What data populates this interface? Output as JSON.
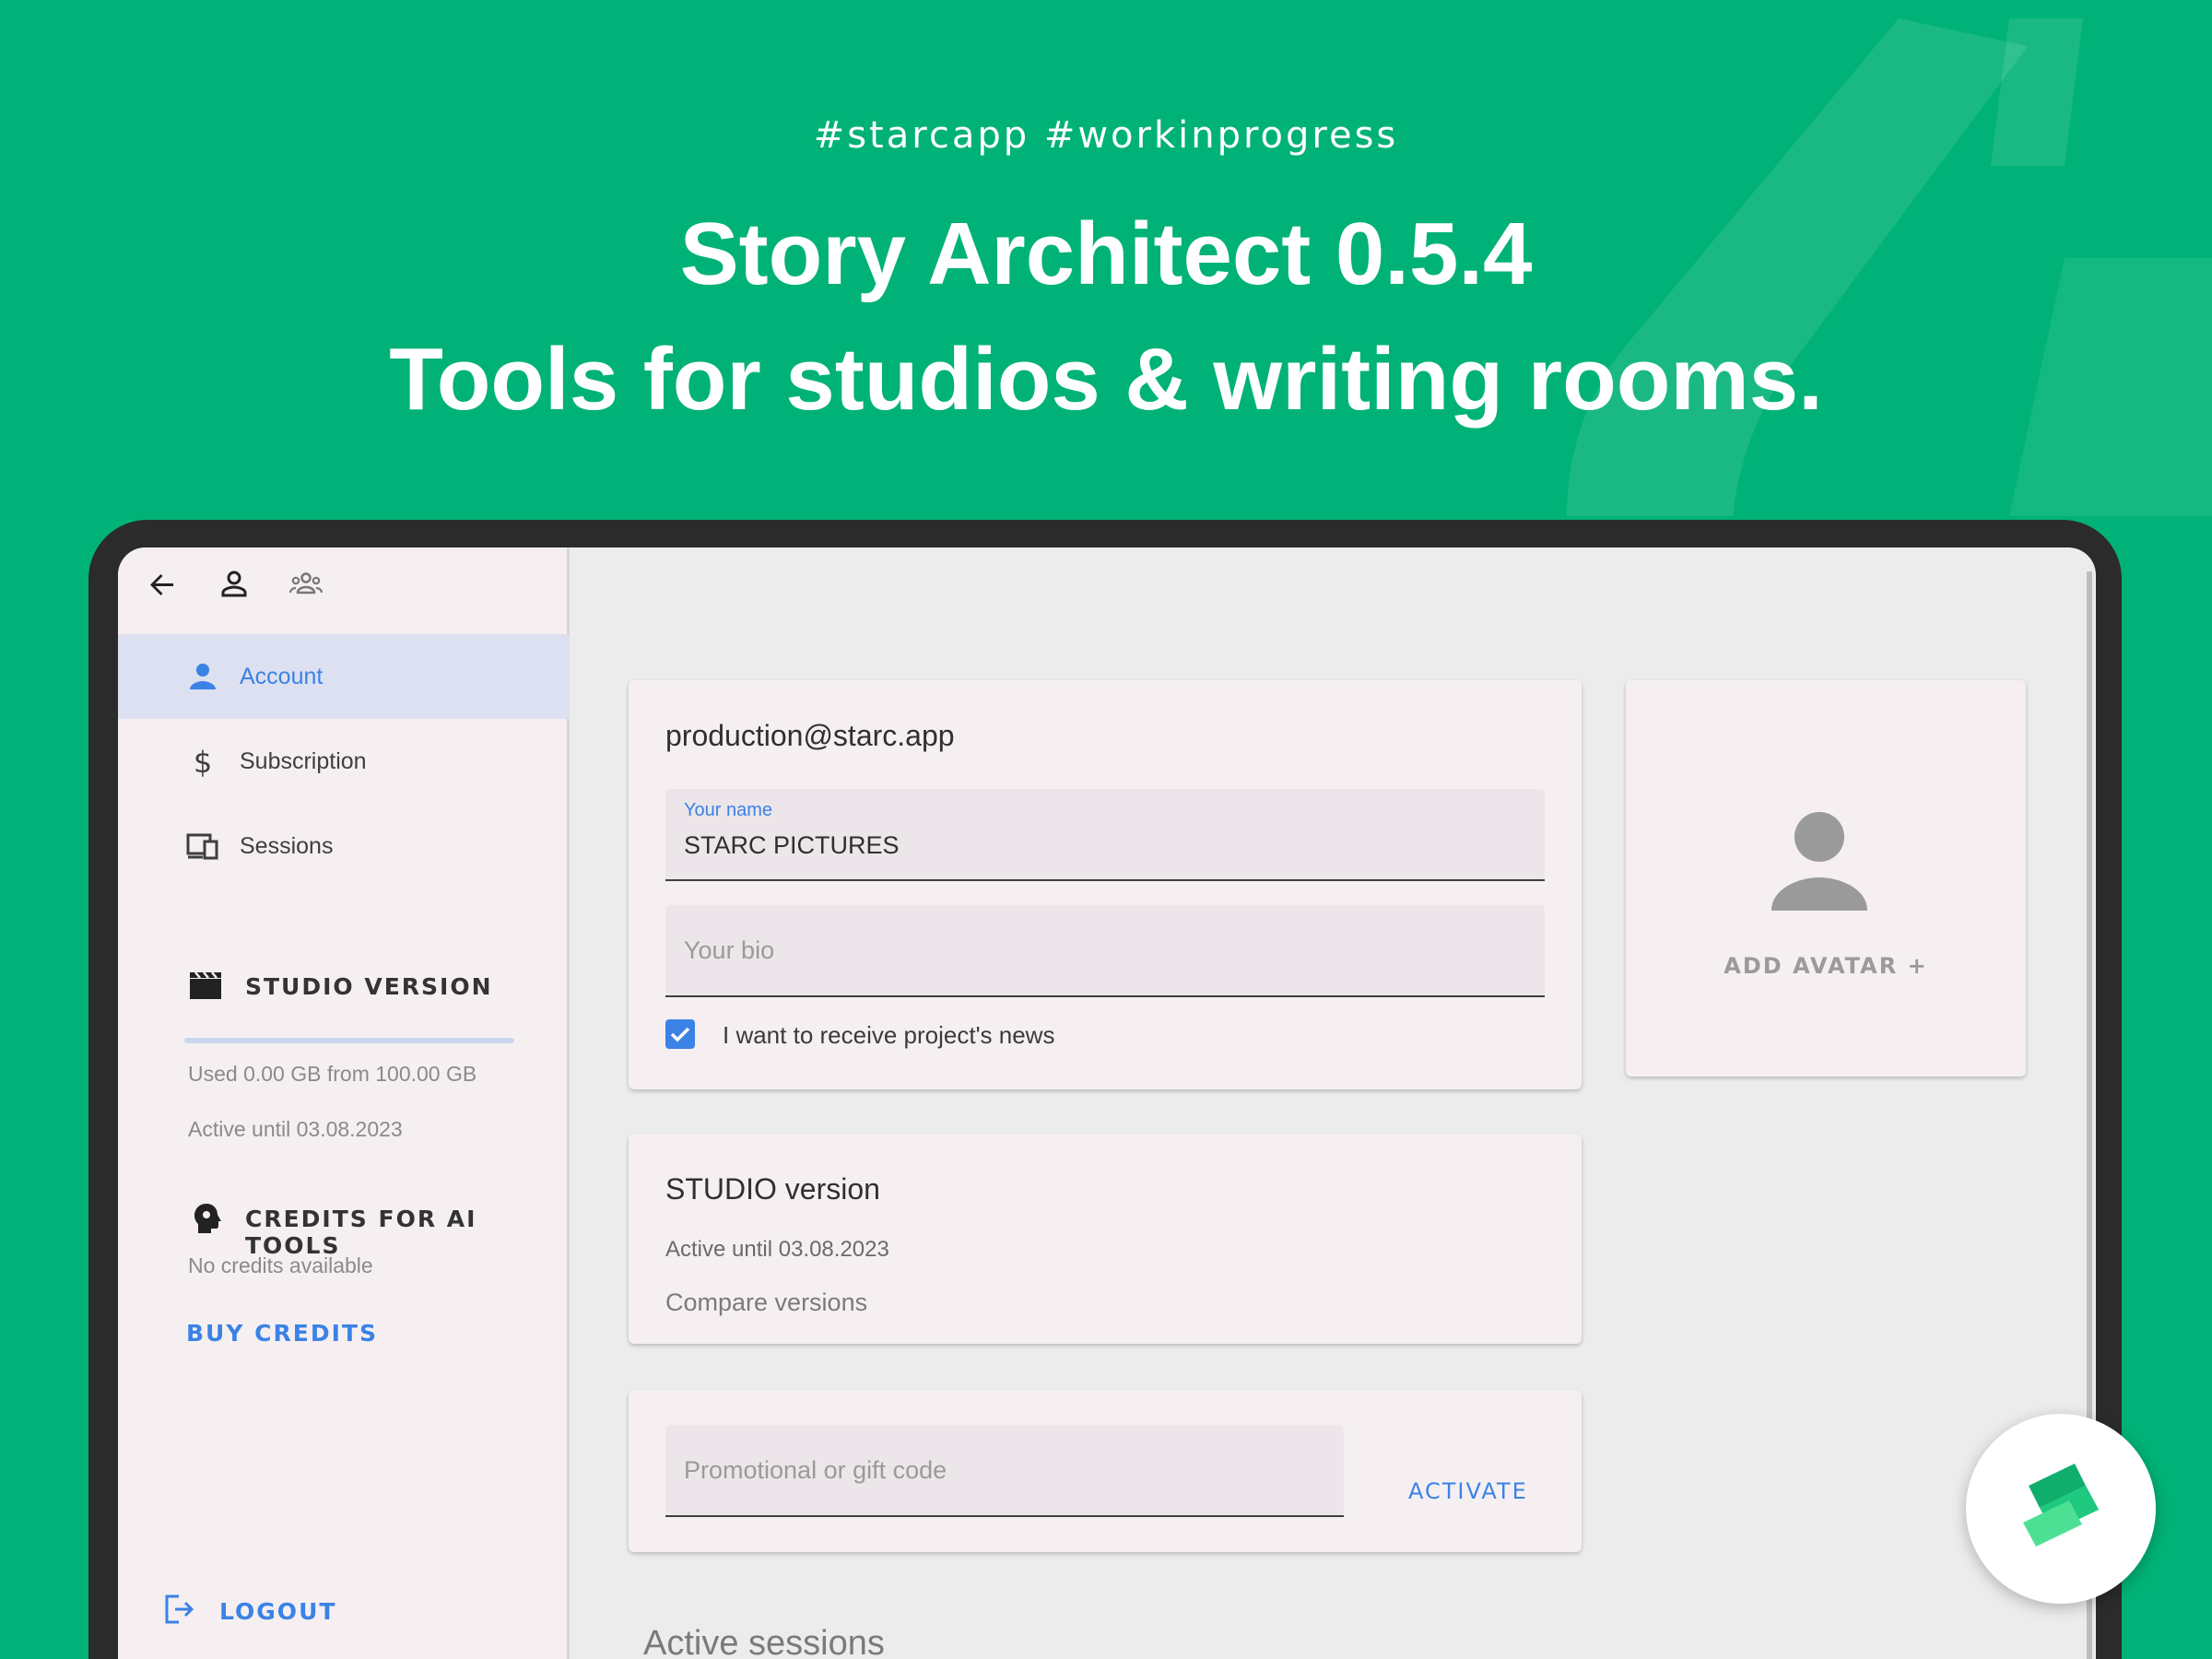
{
  "header": {
    "hashtags": "#starcapp  #workinprogress",
    "title_line1": "Story Architect 0.5.4",
    "title_line2": "Tools for studios & writing rooms."
  },
  "toolbar": {
    "icons": [
      "arrow-left-icon",
      "person-icon",
      "team-icon"
    ]
  },
  "sidebar": {
    "items": [
      {
        "label": "Account",
        "icon": "person-icon",
        "active": true
      },
      {
        "label": "Subscription",
        "icon": "dollar-icon",
        "active": false
      },
      {
        "label": "Sessions",
        "icon": "devices-icon",
        "active": false
      }
    ],
    "studio": {
      "title": "STUDIO VERSION",
      "icon": "clapperboard-icon",
      "storage_text": "Used 0.00 GB from 100.00 GB",
      "storage_used_fraction": 0.0,
      "active_until": "Active until 03.08.2023"
    },
    "credits": {
      "title": "CREDITS FOR AI TOOLS",
      "icon": "brain-head-icon",
      "status": "No credits available",
      "buy_label": "BUY CREDITS"
    },
    "logout_label": "LOGOUT"
  },
  "account_card": {
    "email": "production@starc.app",
    "name_label": "Your name",
    "name_value": "STARC PICTURES",
    "bio_placeholder": "Your bio",
    "news_checkbox_label": "I want to receive project's news",
    "news_checked": true
  },
  "avatar_card": {
    "add_label": "ADD AVATAR +"
  },
  "version_card": {
    "title": "STUDIO version",
    "active_until": "Active until 03.08.2023",
    "compare_label": "Compare versions"
  },
  "promo_card": {
    "placeholder": "Promotional or gift code",
    "activate_label": "ACTIVATE"
  },
  "sessions": {
    "title": "Active sessions"
  },
  "colors": {
    "background": "#00b277",
    "accent": "#3b82e6",
    "device": "#2b2b2b",
    "sidebar_bg": "#f5eff2",
    "active_item_bg": "#dde0f0"
  }
}
